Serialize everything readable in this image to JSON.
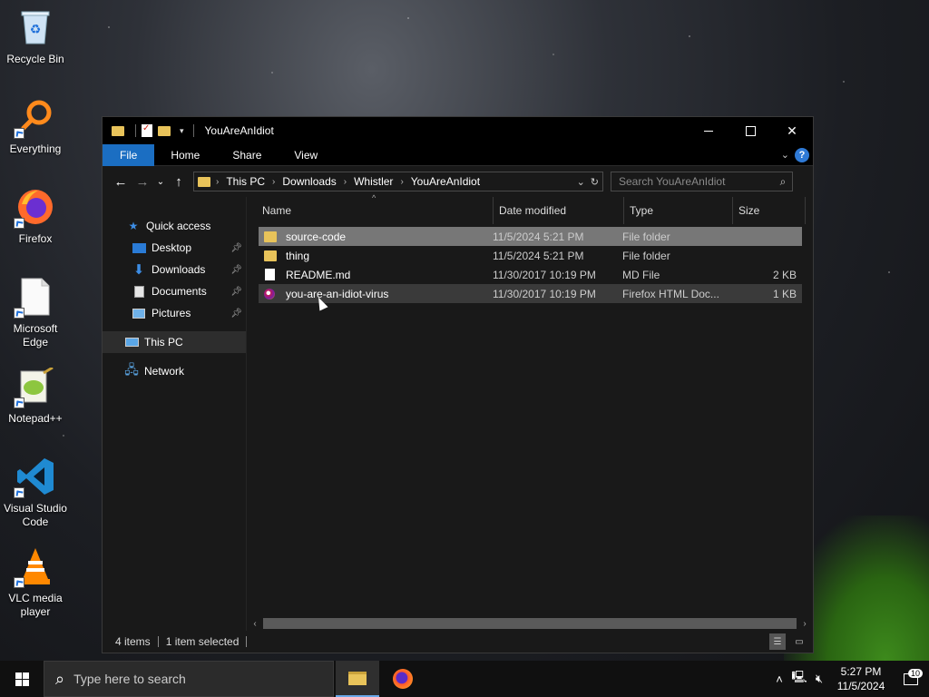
{
  "desktop": {
    "icons": [
      {
        "label": "Recycle Bin",
        "icon": "recycle-bin-icon"
      },
      {
        "label": "Everything",
        "icon": "everything-search-icon"
      },
      {
        "label": "Firefox",
        "icon": "firefox-icon"
      },
      {
        "label": "Microsoft Edge",
        "icon": "edge-file-icon"
      },
      {
        "label": "Notepad++",
        "icon": "notepadpp-icon"
      },
      {
        "label": "Visual Studio Code",
        "icon": "vscode-icon"
      },
      {
        "label": "VLC media player",
        "icon": "vlc-icon"
      }
    ]
  },
  "window": {
    "title": "YouAreAnIdiot",
    "ribbon_tabs": [
      "File",
      "Home",
      "Share",
      "View"
    ],
    "breadcrumb": [
      "This PC",
      "Downloads",
      "Whistler",
      "YouAreAnIdiot"
    ],
    "search_placeholder": "Search YouAreAnIdiot",
    "nav": {
      "quick_access": "Quick access",
      "items": [
        {
          "label": "Desktop",
          "pinned": true
        },
        {
          "label": "Downloads",
          "pinned": true
        },
        {
          "label": "Documents",
          "pinned": true
        },
        {
          "label": "Pictures",
          "pinned": true
        }
      ],
      "this_pc": "This PC",
      "network": "Network"
    },
    "columns": [
      "Name",
      "Date modified",
      "Type",
      "Size"
    ],
    "files": [
      {
        "name": "source-code",
        "date": "11/5/2024 5:21 PM",
        "type": "File folder",
        "size": "",
        "icon": "folder"
      },
      {
        "name": "thing",
        "date": "11/5/2024 5:21 PM",
        "type": "File folder",
        "size": "",
        "icon": "folder"
      },
      {
        "name": "README.md",
        "date": "11/30/2017 10:19 PM",
        "type": "MD File",
        "size": "2 KB",
        "icon": "document"
      },
      {
        "name": "you-are-an-idiot-virus",
        "date": "11/30/2017 10:19 PM",
        "type": "Firefox HTML Doc...",
        "size": "1 KB",
        "icon": "firefox-html"
      }
    ],
    "status": {
      "items": "4 items",
      "selected": "1 item selected"
    }
  },
  "taskbar": {
    "search_placeholder": "Type here to search",
    "time": "5:27 PM",
    "date": "11/5/2024",
    "notification_count": "10"
  }
}
